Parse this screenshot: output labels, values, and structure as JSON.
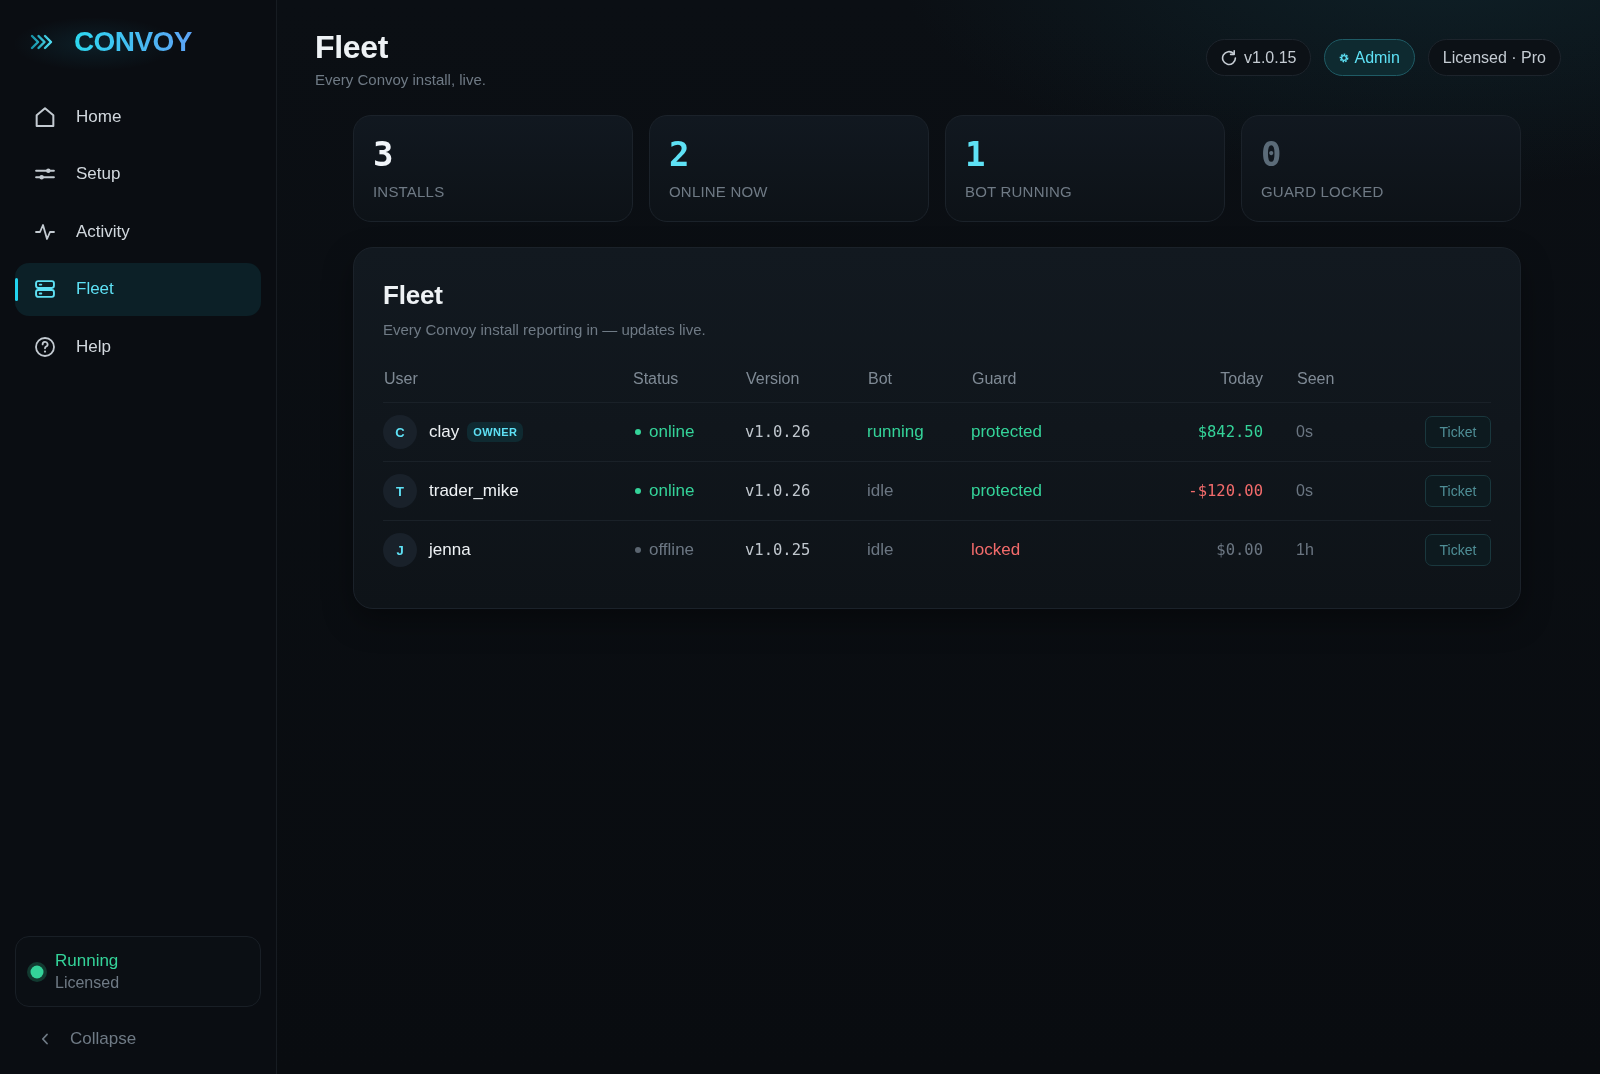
{
  "sidebar": {
    "brand": "CONVOY",
    "items": [
      {
        "label": "Home",
        "selected": false
      },
      {
        "label": "Setup",
        "selected": false
      },
      {
        "label": "Activity",
        "selected": false
      },
      {
        "label": "Fleet",
        "selected": true
      },
      {
        "label": "Help",
        "selected": false
      }
    ],
    "status": {
      "title": "Running",
      "subtitle": "Licensed",
      "running": true
    },
    "collapse": "Collapse"
  },
  "header": {
    "title": "Fleet",
    "subtitle": "Every Convoy install, live.",
    "pills": [
      {
        "kind": "version",
        "label": "v1.0.15"
      },
      {
        "kind": "role",
        "label": "Admin"
      },
      {
        "kind": "license",
        "label": "Licensed · Pro"
      }
    ]
  },
  "stats": [
    {
      "value": "3",
      "label": "INSTALLS",
      "color": "#f1f5f9"
    },
    {
      "value": "2",
      "label": "ONLINE NOW",
      "color": "#5ee1f5"
    },
    {
      "value": "1",
      "label": "BOT RUNNING",
      "color": "#5ee1f5"
    },
    {
      "value": "0",
      "label": "GUARD LOCKED",
      "color": "#5b6b78"
    }
  ],
  "table": {
    "title": "Fleet",
    "subtitle": "Every Convoy install reporting in — updates live.",
    "columns": [
      "User",
      "Status",
      "Version",
      "Bot",
      "Guard",
      "Today",
      "Seen"
    ],
    "rows": [
      {
        "initial": "C",
        "user": "clay",
        "badge": "OWNER",
        "status": "online",
        "online": true,
        "version": "v1.0.26",
        "bot": "running",
        "running": true,
        "guard": "protected",
        "locked": false,
        "today": "$842.50",
        "gain": true,
        "loss": false,
        "seen": "0s",
        "action": "Ticket"
      },
      {
        "initial": "T",
        "user": "trader_mike",
        "status": "online",
        "online": true,
        "version": "v1.0.26",
        "bot": "idle",
        "running": false,
        "guard": "protected",
        "locked": false,
        "today": "-$120.00",
        "gain": false,
        "loss": true,
        "seen": "0s",
        "action": "Ticket"
      },
      {
        "initial": "J",
        "user": "jenna",
        "status": "offline",
        "online": false,
        "version": "v1.0.25",
        "bot": "idle",
        "running": false,
        "guard": "locked",
        "locked": true,
        "today": "$0.00",
        "gain": false,
        "loss": false,
        "seen": "1h",
        "action": "Ticket"
      }
    ]
  }
}
